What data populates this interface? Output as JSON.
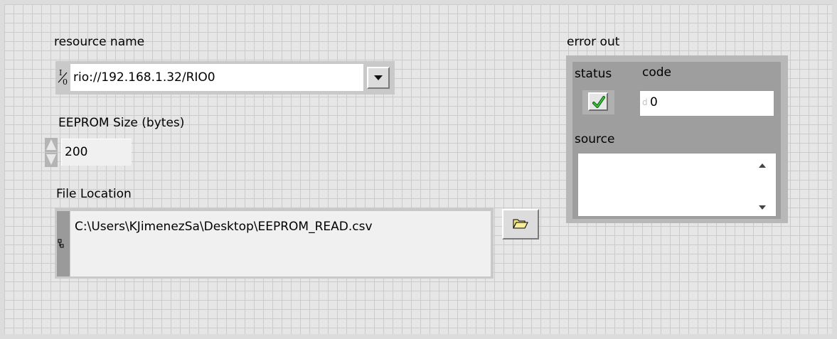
{
  "resource": {
    "label": "resource name",
    "io_glyph": "I/O",
    "value": "rio://192.168.1.32/RIO0",
    "dropdown_icon": "chevron-down-icon"
  },
  "eeprom": {
    "label": "EEPROM Size (bytes)",
    "value": "200"
  },
  "file": {
    "label": "File Location",
    "path": "C:\\Users\\KJimenezSa\\Desktop\\EEPROM_READ.csv",
    "browse_icon": "folder-open-icon"
  },
  "error_out": {
    "label": "error out",
    "status_label": "status",
    "status_icon": "checkmark-icon",
    "code_label": "code",
    "code_radix": "d",
    "code_value": "0",
    "source_label": "source",
    "source_value": ""
  },
  "colors": {
    "panel_bg": "#e6e6e6",
    "grid": "#cbcbcb",
    "status_ok": "#20a020"
  }
}
